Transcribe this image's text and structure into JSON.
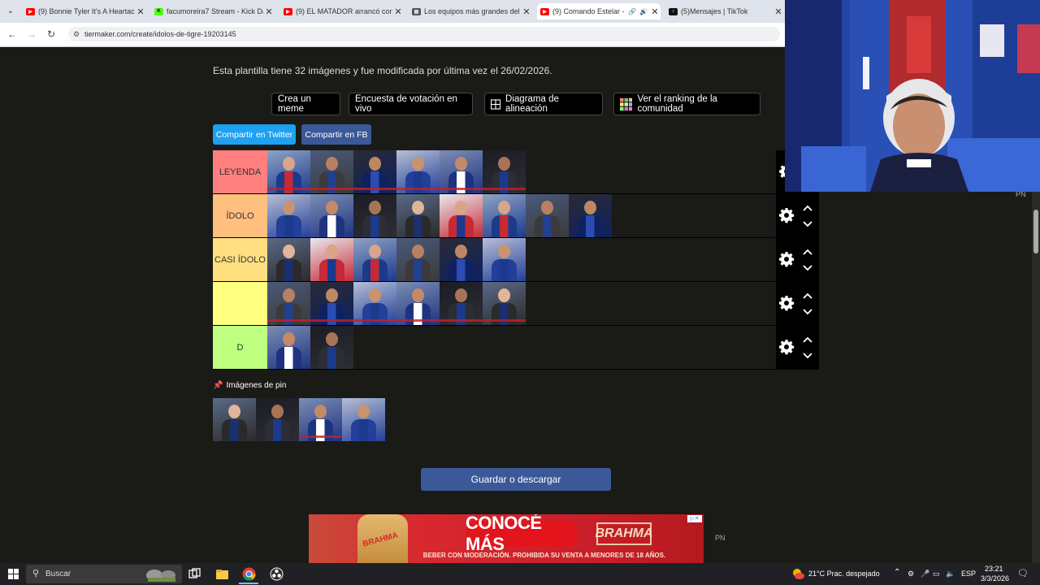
{
  "browser": {
    "tabs": [
      {
        "title": "(9) Bonnie Tyler It's A Heartach",
        "favicon": "youtube-icon",
        "active": false
      },
      {
        "title": "facumoreira7 Stream - Kick Da",
        "favicon": "kick-icon",
        "active": false
      },
      {
        "title": "(9) EL MATADOR arrancó con d",
        "favicon": "youtube-icon",
        "active": false
      },
      {
        "title": "Los equipos más grandes del f",
        "favicon": "page-icon",
        "active": false
      },
      {
        "title": "(9) Comando Estelar - G",
        "favicon": "youtube-icon",
        "active": true
      },
      {
        "title": "(5)Mensajes | TikTok",
        "favicon": "tiktok-icon",
        "active": false
      }
    ],
    "url": "tiermaker.com/create/idolos-de-tigre-19203145"
  },
  "page": {
    "template_info": "Esta plantilla tiene 32 imágenes y fue modificada por última vez el 26/02/2026.",
    "buttons": {
      "meme": "Crea un meme",
      "poll": "Encuesta de votación en vivo",
      "alignment": "Diagrama de alineación",
      "ranking": "Ver el ranking de la comunidad"
    },
    "share": {
      "twitter": "Compartir en Twitter",
      "facebook": "Compartir en FB"
    },
    "tiers": [
      {
        "label": "LEYENDA",
        "color": "#ff7f7f",
        "count": 6
      },
      {
        "label": "ÍDOLO",
        "color": "#ffbf7f",
        "count": 8
      },
      {
        "label": "CASI ÍDOLO",
        "color": "#ffdf7f",
        "count": 6
      },
      {
        "label": "",
        "color": "#ffff7f",
        "count": 6
      },
      {
        "label": "D",
        "color": "#bfff7f",
        "count": 2
      }
    ],
    "pin_label": "Imágenes de pin",
    "pin_count": 4,
    "save_label": "Guardar o descargar"
  },
  "ad": {
    "cta": "CONOCÉ MÁS",
    "brand": "BRAHMA",
    "bottle_text": "BRAHMA",
    "note": "BEBER CON MODERACIÓN. PROHIBIDA SU VENTA A MENORES DE 18 AÑOS.",
    "close": "▷✕"
  },
  "side_labels": {
    "pn_right": "PN",
    "pn_bottom": "PN"
  },
  "taskbar": {
    "search_placeholder": "Buscar",
    "weather": "21°C  Prac. despejado",
    "language": "ESP",
    "time": "23:21",
    "date": "3/3/2026"
  }
}
